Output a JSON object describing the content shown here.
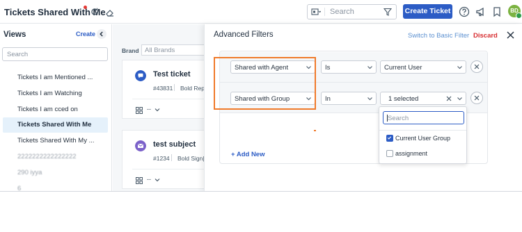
{
  "header": {
    "title": "Tickets Shared With Me",
    "search_placeholder": "Search",
    "create_ticket_label": "Create Ticket",
    "avatar_initials": "BD"
  },
  "sidebar": {
    "title": "Views",
    "create_label": "Create",
    "search_placeholder": "Search",
    "items": [
      {
        "label": "Tickets I am Mentioned ..."
      },
      {
        "label": "Tickets I am Watching"
      },
      {
        "label": "Tickets I am cced on"
      },
      {
        "label": "Tickets Shared With Me",
        "active": true
      },
      {
        "label": "Tickets Shared With My ..."
      },
      {
        "label": "2222222222222222"
      },
      {
        "label": "290 iyya"
      },
      {
        "label": "6"
      }
    ]
  },
  "list": {
    "brand_label": "Brand",
    "brand_value": "All Brands",
    "tickets": [
      {
        "subject": "Test ticket",
        "number": "#43831",
        "meta": "Bold Rep",
        "property_dash": "--",
        "icon_color": "#2c5cc5"
      },
      {
        "subject": "test subject",
        "number": "#1234",
        "meta": "Bold Sign|",
        "property_dash": "--",
        "icon_color": "#7b61c9"
      }
    ]
  },
  "advanced_filters": {
    "title": "Advanced Filters",
    "switch_label": "Switch to Basic Filter",
    "discard_label": "Discard",
    "rows": [
      {
        "field": "Shared with Agent",
        "operator": "Is",
        "value": "Current User"
      },
      {
        "field": "Shared with Group",
        "operator": "In",
        "value": "1 selected"
      }
    ],
    "add_new_label": "Add New",
    "dropdown": {
      "search_placeholder": "Search",
      "options": [
        {
          "label": "Current User Group",
          "checked": true
        },
        {
          "label": "assignment",
          "checked": false
        }
      ]
    }
  },
  "colors": {
    "primary": "#2c5cc5",
    "discard": "#d72d30",
    "highlight": "#f07a2a",
    "active_view_bg": "#e5f1fb"
  }
}
